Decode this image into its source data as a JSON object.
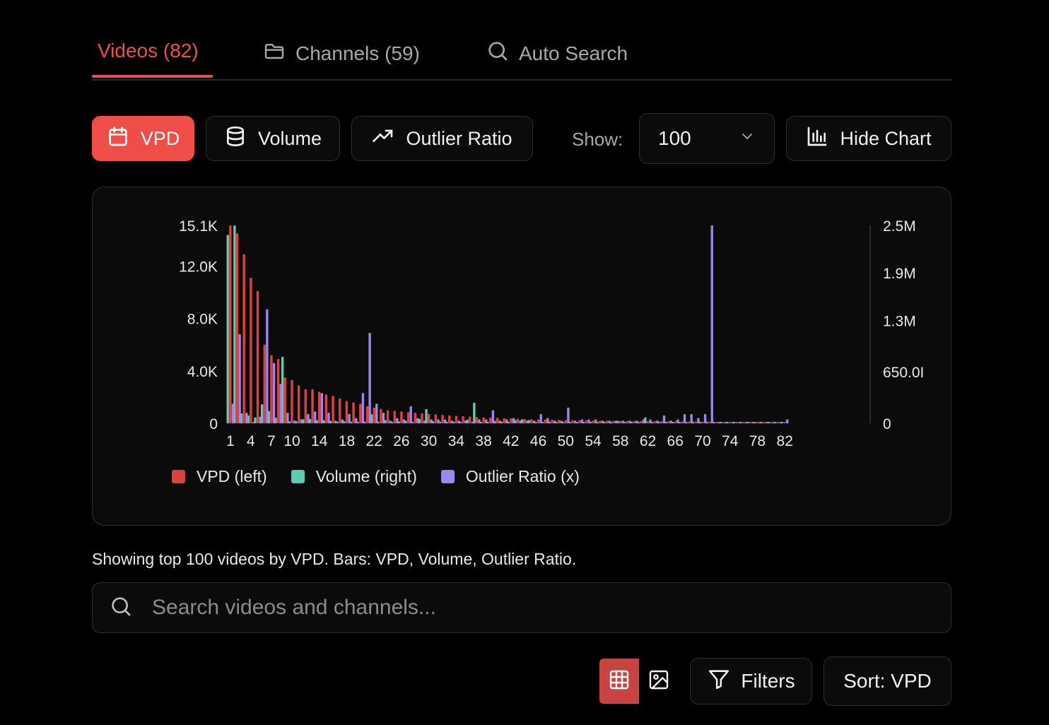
{
  "tabs": [
    {
      "label": "Videos (82)",
      "icon": "none",
      "active": true
    },
    {
      "label": "Channels (59)",
      "icon": "folder-icon",
      "active": false
    },
    {
      "label": "Auto Search",
      "icon": "search-icon",
      "active": false
    }
  ],
  "toolbar": {
    "metric_buttons": [
      {
        "label": "VPD",
        "icon": "calendar-icon",
        "active": true
      },
      {
        "label": "Volume",
        "icon": "database-icon",
        "active": false
      },
      {
        "label": "Outlier Ratio",
        "icon": "trending-up-icon",
        "active": false
      }
    ],
    "show_label": "Show:",
    "show_value": "100",
    "hide_chart_label": "Hide Chart"
  },
  "colors": {
    "accent": "#ef4d48",
    "vpd": "#e0413b",
    "volume": "#5fc9b5",
    "outlier": "#9b87f0"
  },
  "chart_data": {
    "type": "bar",
    "x_ticks": [
      "1",
      "4",
      "7",
      "10",
      "14",
      "18",
      "22",
      "26",
      "30",
      "34",
      "38",
      "42",
      "46",
      "50",
      "54",
      "58",
      "62",
      "66",
      "70",
      "74",
      "78",
      "82"
    ],
    "y_left_ticks": [
      "0",
      "4.0K",
      "8.0K",
      "12.0K",
      "15.1K"
    ],
    "y_right_ticks": [
      "0",
      "650.0I",
      "1.3M",
      "1.9M",
      "2.5M"
    ],
    "ylim_left": [
      0,
      15100
    ],
    "ylim_right": [
      0,
      2500000
    ],
    "legend": [
      "VPD (left)",
      "Volume (right)",
      "Outlier Ratio (x)"
    ],
    "x": [
      1,
      2,
      3,
      4,
      5,
      6,
      7,
      8,
      9,
      10,
      11,
      12,
      13,
      14,
      15,
      16,
      17,
      18,
      19,
      20,
      21,
      22,
      23,
      24,
      25,
      26,
      27,
      28,
      29,
      30,
      31,
      32,
      33,
      34,
      35,
      36,
      37,
      38,
      39,
      40,
      41,
      42,
      43,
      44,
      45,
      46,
      47,
      48,
      49,
      50,
      51,
      52,
      53,
      54,
      55,
      56,
      57,
      58,
      59,
      60,
      61,
      62,
      63,
      64,
      65,
      66,
      67,
      68,
      69,
      70,
      71,
      72,
      73,
      74,
      75,
      76,
      77,
      78,
      79,
      80,
      81,
      82
    ],
    "series": [
      {
        "name": "VPD (left)",
        "axis": "left",
        "values": [
          15100,
          14500,
          12900,
          11100,
          10100,
          6000,
          5200,
          4900,
          3500,
          3300,
          2900,
          2600,
          2600,
          2400,
          2200,
          2100,
          1900,
          1700,
          1600,
          1500,
          1300,
          1200,
          1100,
          1000,
          950,
          900,
          850,
          800,
          760,
          720,
          680,
          640,
          600,
          570,
          540,
          510,
          480,
          450,
          430,
          410,
          390,
          370,
          350,
          330,
          310,
          300,
          280,
          270,
          260,
          250,
          240,
          230,
          220,
          210,
          200,
          195,
          190,
          185,
          180,
          175,
          170,
          165,
          160,
          155,
          150,
          145,
          140,
          135,
          130,
          125,
          120,
          115,
          110,
          105,
          100,
          95,
          90,
          85,
          80,
          75,
          70,
          65
        ]
      },
      {
        "name": "Volume (right)",
        "axis": "right",
        "values": [
          2380000,
          2500000,
          125000,
          100000,
          75000,
          240000,
          155000,
          70000,
          840000,
          25000,
          25000,
          50000,
          55000,
          40000,
          40000,
          30000,
          20000,
          25000,
          20000,
          15000,
          20000,
          115000,
          15000,
          40000,
          15000,
          25000,
          30000,
          10000,
          55000,
          180000,
          25000,
          20000,
          10000,
          20000,
          10000,
          45000,
          260000,
          10000,
          10000,
          30000,
          20000,
          20000,
          40000,
          50000,
          40000,
          10000,
          10000,
          20000,
          10000,
          15000,
          10000,
          10000,
          10000,
          10000,
          10000,
          10000,
          10000,
          30000,
          10000,
          10000,
          10000,
          75000,
          10000,
          10000,
          10000,
          10000,
          10000,
          10000,
          10000,
          10000,
          10000,
          10000,
          10000,
          10000,
          10000,
          10000,
          10000,
          10000,
          10000,
          10000,
          10000,
          10000
        ]
      },
      {
        "name": "Outlier Ratio (x)",
        "axis": "left",
        "values": [
          1500,
          6800,
          800,
          100,
          500,
          8700,
          4600,
          3000,
          800,
          200,
          300,
          700,
          900,
          2300,
          800,
          200,
          300,
          700,
          400,
          2300,
          6900,
          1500,
          800,
          200,
          400,
          300,
          1300,
          400,
          200,
          300,
          300,
          300,
          200,
          200,
          200,
          100,
          300,
          300,
          1000,
          200,
          300,
          400,
          200,
          200,
          200,
          700,
          400,
          200,
          200,
          1200,
          200,
          300,
          300,
          300,
          200,
          200,
          200,
          200,
          200,
          200,
          300,
          300,
          200,
          600,
          200,
          300,
          700,
          700,
          400,
          700,
          15100,
          100,
          100,
          100,
          100,
          100,
          100,
          100,
          100,
          100,
          100,
          300
        ]
      }
    ]
  },
  "caption": "Showing top 100 videos by VPD. Bars: VPD, Volume, Outlier Ratio.",
  "search": {
    "placeholder": "Search videos and channels..."
  },
  "bottom": {
    "grid_view_icon": "grid-icon",
    "image_view_icon": "image-icon",
    "filters_label": "Filters",
    "sort_label": "Sort: VPD"
  }
}
